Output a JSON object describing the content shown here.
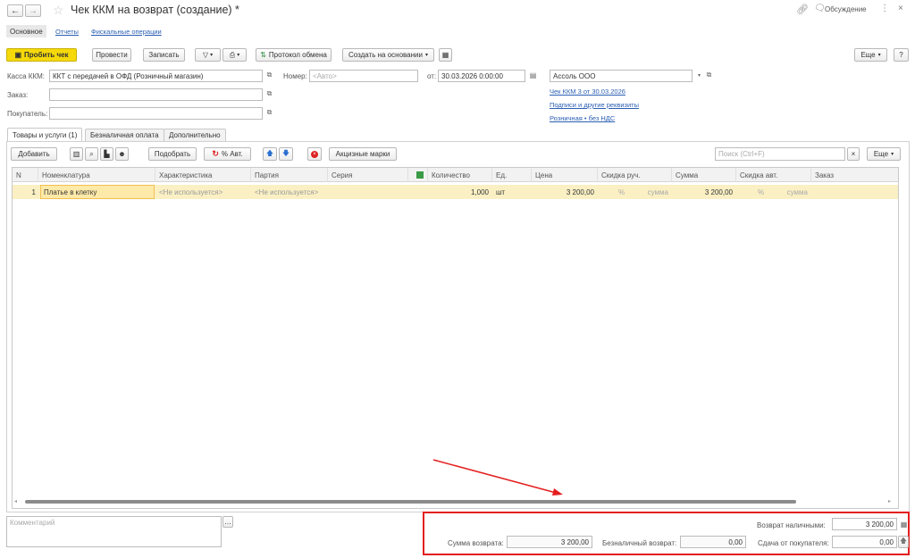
{
  "window": {
    "title": "Чек ККМ на возврат (создание) *",
    "discussion": "Обсуждение"
  },
  "nav_tabs": [
    "Основное",
    "Отчеты",
    "Фискальные операции"
  ],
  "toolbar": {
    "print_check": "Пробить чек",
    "post": "Провести",
    "save": "Записать",
    "exchange_log": "Протокол обмена",
    "create_based_on": "Создать на основании",
    "more": "Еще",
    "help": "?"
  },
  "form": {
    "kassa_label": "Касса ККМ:",
    "kassa_value": "ККТ с передачей в ОФД (Розничный магазин)",
    "number_label": "Номер:",
    "number_placeholder": "<Авто>",
    "date_label": "от:",
    "date_value": "30.03.2026  0:00:00",
    "org_value": "Ассоль ООО",
    "order_label": "Заказ:",
    "buyer_label": "Покупатель:",
    "links": [
      "Чек ККМ 3 от 30.03.2026",
      "Подписи и другие реквизиты",
      "Розничная • без НДС"
    ]
  },
  "section_tabs": [
    "Товары и услуги (1)",
    "Безналичная оплата",
    "Дополнительно"
  ],
  "table_toolbar": {
    "add": "Добавить",
    "pick": "Подобрать",
    "percent_auto": "% Авт.",
    "excise": "Акцизные марки",
    "search_placeholder": "Поиск (Ctrl+F)",
    "more": "Еще"
  },
  "table": {
    "columns": [
      "N",
      "Номенклатура",
      "Характеристика",
      "Партия",
      "Серия",
      "Количество",
      "Ед.",
      "Цена",
      "Скидка руч.",
      "Сумма",
      "Скидка авт.",
      "Заказ"
    ],
    "rows": [
      {
        "n": "1",
        "item": "Платье в клетку",
        "characteristic": "<Не используется>",
        "batch": "<Не используется>",
        "series": "",
        "qty": "1,000",
        "unit": "шт",
        "price": "3 200,00",
        "disc_manual_pct": "%",
        "disc_manual_sum": "сумма",
        "sum": "3 200,00",
        "disc_auto_pct": "%",
        "disc_auto_sum": "сумма",
        "order": ""
      }
    ]
  },
  "footer": {
    "comment_placeholder": "Комментарий",
    "cash_return_label": "Возврат наличными:",
    "cash_return_value": "3 200,00",
    "return_sum_label": "Сумма возврата:",
    "return_sum_value": "3 200,00",
    "noncash_label": "Безналичный возврат:",
    "noncash_value": "0,00",
    "change_label": "Сдача от покупателя:",
    "change_value": "0,00"
  },
  "colors": {
    "accent_yellow": "#f5d90a",
    "row_highlight": "#fbf0c4",
    "annotation_red": "#e41e1e",
    "link_blue": "#2a5eb3"
  }
}
